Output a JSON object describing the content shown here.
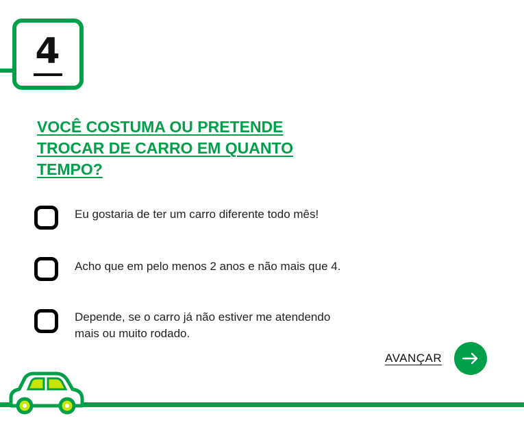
{
  "step": {
    "number": "4"
  },
  "question": {
    "text": "VOCÊ COSTUMA OU PRETENDE TROCAR DE CARRO EM QUANTO TEMPO?"
  },
  "options": [
    {
      "label": "Eu gostaria de ter um carro diferente todo mês!",
      "checked": false
    },
    {
      "label": "Acho que em pelo menos 2 anos e não mais que 4.",
      "checked": false
    },
    {
      "label": "Depende, se o carro já não estiver me atendendo mais ou muito rodado.",
      "checked": false
    }
  ],
  "navigation": {
    "next_label": "AVANÇAR",
    "next_icon": "arrow-right-icon"
  },
  "colors": {
    "brand_green": "#00a04a",
    "car_yellow": "#c8e600"
  },
  "illustration": {
    "icon": "car-icon"
  }
}
